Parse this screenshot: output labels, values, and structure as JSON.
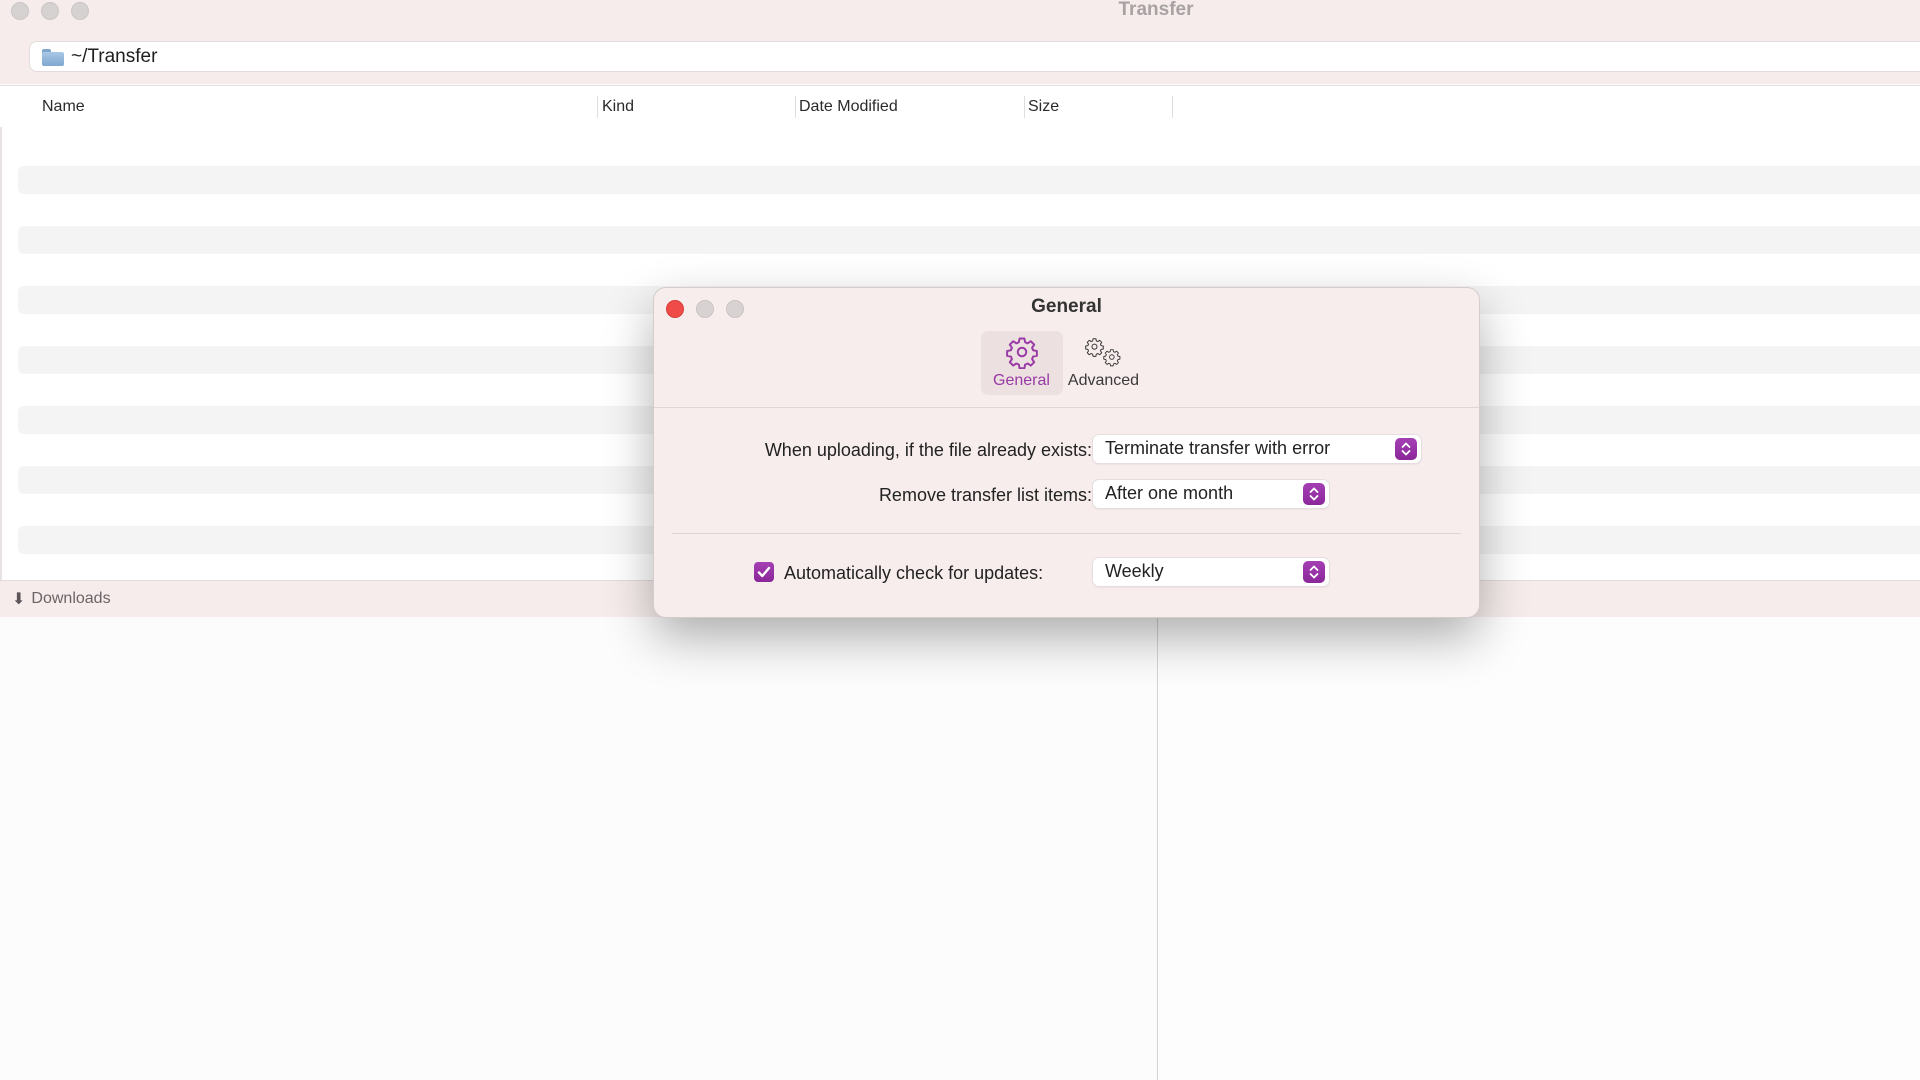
{
  "window": {
    "title": "Transfer",
    "path": "~/Transfer"
  },
  "file_list": {
    "columns": [
      "Name",
      "Kind",
      "Date Modified",
      "Size"
    ],
    "rows": []
  },
  "downloads_bar": {
    "icon": "download-arrow-icon",
    "label": "Downloads"
  },
  "preferences_dialog": {
    "title": "General",
    "tabs": [
      {
        "label": "General",
        "icon": "gear-icon",
        "active": true
      },
      {
        "label": "Advanced",
        "icon": "gears-icon",
        "active": false
      }
    ],
    "settings": {
      "upload_exists_label": "When uploading, if the file already exists:",
      "upload_exists_value": "Terminate transfer with error",
      "remove_items_label": "Remove transfer list items:",
      "remove_items_value": "After one month",
      "auto_update_label": "Automatically check for updates:",
      "auto_update_checked": true,
      "auto_update_value": "Weekly"
    }
  },
  "colors": {
    "accent": "#9a2fa8",
    "close_button": "#ef4c49",
    "titlebar_bg": "#f6ecec"
  }
}
